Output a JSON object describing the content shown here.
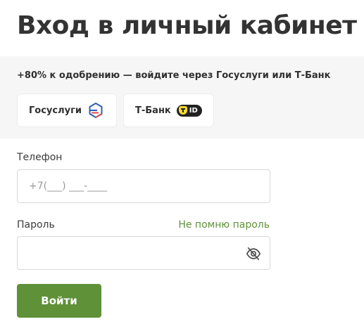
{
  "page": {
    "title": "Вход в личный кабинет"
  },
  "promo": {
    "text": "+80% к одобрению — войдите через Госуслуги или Т-Банк"
  },
  "sso": {
    "gosuslugi_label": "Госуслуги",
    "tbank_label": "Т-Банк",
    "tbank_badge": "ID",
    "icons": {
      "gosuslugi": "gosuslugi-logo-icon",
      "tbank": "tbank-id-icon"
    }
  },
  "form": {
    "phone_label": "Телефон",
    "phone_placeholder": "+7(___) ___-____",
    "password_label": "Пароль",
    "password_placeholder": "",
    "forgot_link": "Не помню пароль",
    "submit_label": "Войти",
    "password_toggle_icon": "eye-slash-icon"
  },
  "colors": {
    "accent": "#5f9138",
    "panel_bg": "#f6f6f6",
    "gos_blue": "#2d5fb0",
    "gos_red": "#e24a4a",
    "tbank_yellow": "#ffdd2d"
  }
}
